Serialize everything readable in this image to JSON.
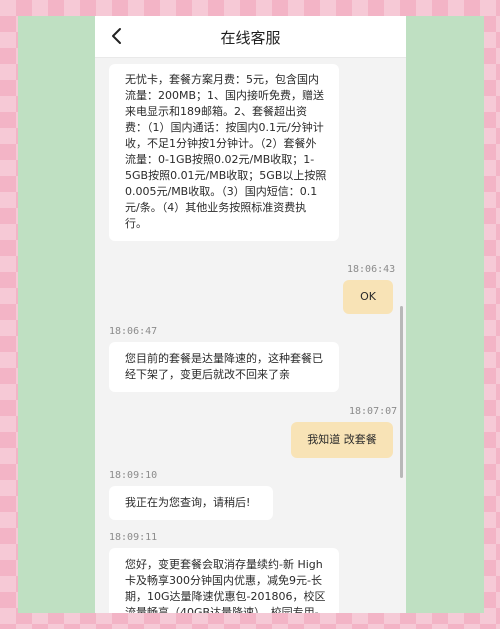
{
  "app": {
    "title": "在线客服"
  },
  "messages": [
    {
      "side": "left",
      "text": "无忧卡，套餐方案月费：5元，包含国内流量：200MB；1、国内接听免费，赠送来电显示和189邮箱。2、套餐超出资费：（1）国内通话：按国内0.1元/分钟计收，不足1分钟按1分钟计。（2）套餐外流量：0-1GB按照0.02元/MB收取；1-5GB按照0.01元/MB收取；5GB以上按照0.005元/MB收取。（3）国内短信：0.1元/条。（4）其他业务按照标准资费执行。"
    },
    {
      "side": "right",
      "time": "18:06:43",
      "text": "OK"
    },
    {
      "side": "left",
      "time": "18:06:47",
      "text": "您目前的套餐是达量降速的，这种套餐已经下架了，变更后就改不回来了亲"
    },
    {
      "side": "right",
      "time": "18:07:07",
      "text": "我知道 改套餐"
    },
    {
      "side": "left",
      "time": "18:09:10",
      "text": "我正在为您查询，请稍后!"
    },
    {
      "side": "left",
      "time": "18:09:11",
      "text": "您好，变更套餐会取消存量续约-新 High卡及畅享300分钟国内优惠，减免9元-长期，10G达量降速优惠包-201806，校区流量畅享（40GB达量降速），校园专用-"
    }
  ]
}
